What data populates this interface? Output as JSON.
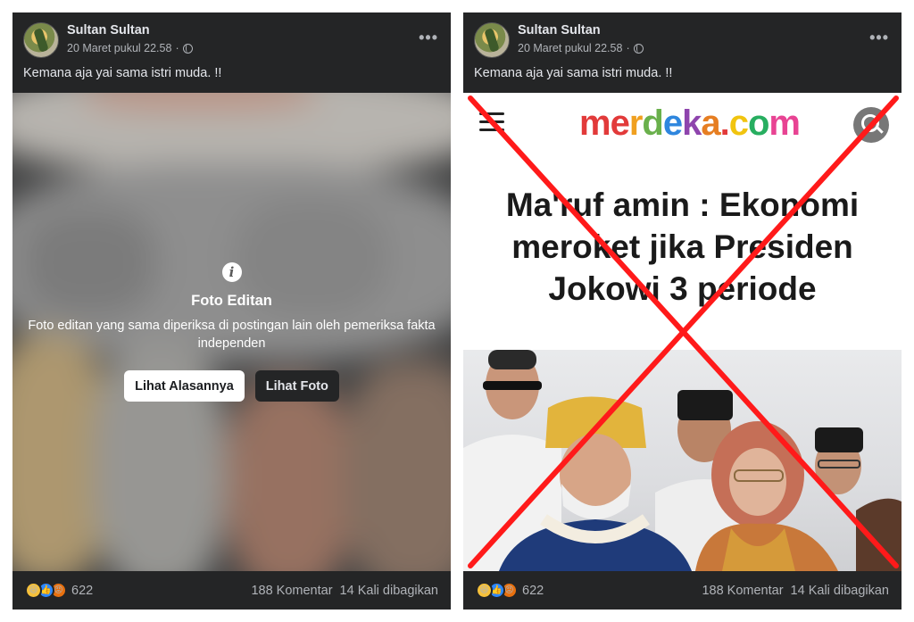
{
  "posts": [
    {
      "author": "Sultan Sultan",
      "timestamp": "20 Maret pukul 22.58",
      "privacy_separator": "·",
      "caption": "Kemana aja yai sama istri muda. !!",
      "more_label": "•••",
      "warning": {
        "icon": "info-icon",
        "title": "Foto Editan",
        "description": "Foto editan yang sama diperiksa di postingan lain oleh pemeriksa fakta independen",
        "reason_button": "Lihat Alasannya",
        "view_button": "Lihat Foto"
      },
      "reactions": {
        "icons": [
          "haha-icon",
          "like-icon",
          "angry-icon"
        ],
        "count": "622"
      },
      "comments": "188 Komentar",
      "shares": "14 Kali dibagikan"
    },
    {
      "author": "Sultan Sultan",
      "timestamp": "20 Maret pukul 22.58",
      "privacy_separator": "·",
      "caption": "Kemana aja yai sama istri muda. !!",
      "more_label": "•••",
      "article": {
        "logo": "merdeka.com",
        "logo_colors": [
          "#e23a3a",
          "#e23a3a",
          "#f0a020",
          "#6ab04c",
          "#2e86de",
          "#8e44ad",
          "#e67e22",
          "#e23a3a",
          "#f1c40f",
          "#27ae60",
          "#e84393"
        ],
        "headline_lines": [
          "Ma'ruf amin : Ekonomi",
          "meroket jika Presiden",
          "Jokowi 3 periode"
        ]
      },
      "cross_color": "#ff1a1a",
      "reactions": {
        "icons": [
          "haha-icon",
          "like-icon",
          "angry-icon"
        ],
        "count": "622"
      },
      "comments": "188 Komentar",
      "shares": "14 Kali dibagikan"
    }
  ]
}
